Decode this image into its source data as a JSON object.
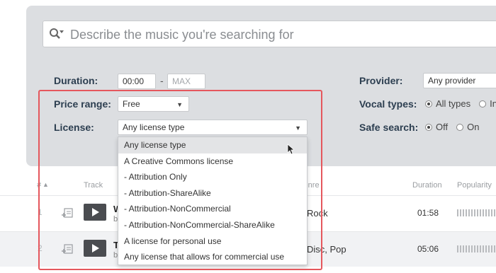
{
  "search": {
    "placeholder": "Describe the music you're searching for"
  },
  "filters": {
    "duration": {
      "label": "Duration:",
      "min_value": "00:00",
      "separator": "-",
      "max_placeholder": "MAX"
    },
    "price_range": {
      "label": "Price range:",
      "value": "Free"
    },
    "license": {
      "label": "License:",
      "value": "Any license type"
    },
    "provider": {
      "label": "Provider:",
      "value": "Any provider"
    },
    "vocal_types": {
      "label": "Vocal types:",
      "options": [
        "All types",
        "In"
      ],
      "selected": "All types"
    },
    "safe_search": {
      "label": "Safe search:",
      "options": [
        "Off",
        "On"
      ],
      "selected": "Off"
    }
  },
  "license_dropdown": {
    "options": [
      "Any license type",
      "A Creative Commons license",
      "- Attribution Only",
      "- Attribution-ShareAlike",
      "- Attribution-NonCommercial",
      "- Attribution-NonCommercial-ShareAlike",
      "A license for personal use",
      "Any license that allows for commercial use"
    ],
    "hovered": "Any license type"
  },
  "table": {
    "headers": {
      "number": "#",
      "sort_indicator": "▲",
      "track": "Track",
      "genre": "Genre",
      "duration": "Duration",
      "popularity": "Popularity"
    },
    "rows": [
      {
        "number": "1",
        "title": "W",
        "by": "b",
        "genre": "Rock",
        "duration": "01:58"
      },
      {
        "number": "2",
        "title": "T",
        "by": "b",
        "genre": "Disc, Pop",
        "duration": "05:06"
      }
    ]
  },
  "colors": {
    "panel": "#dcdee1",
    "highlight_border": "#e5575d",
    "play_button": "#4a4c50",
    "hover_row": "#e3e4e6"
  },
  "icons": [
    "search-icon",
    "chevron-down-icon",
    "add-to-queue-icon",
    "play-icon",
    "mouse-pointer-icon"
  ]
}
